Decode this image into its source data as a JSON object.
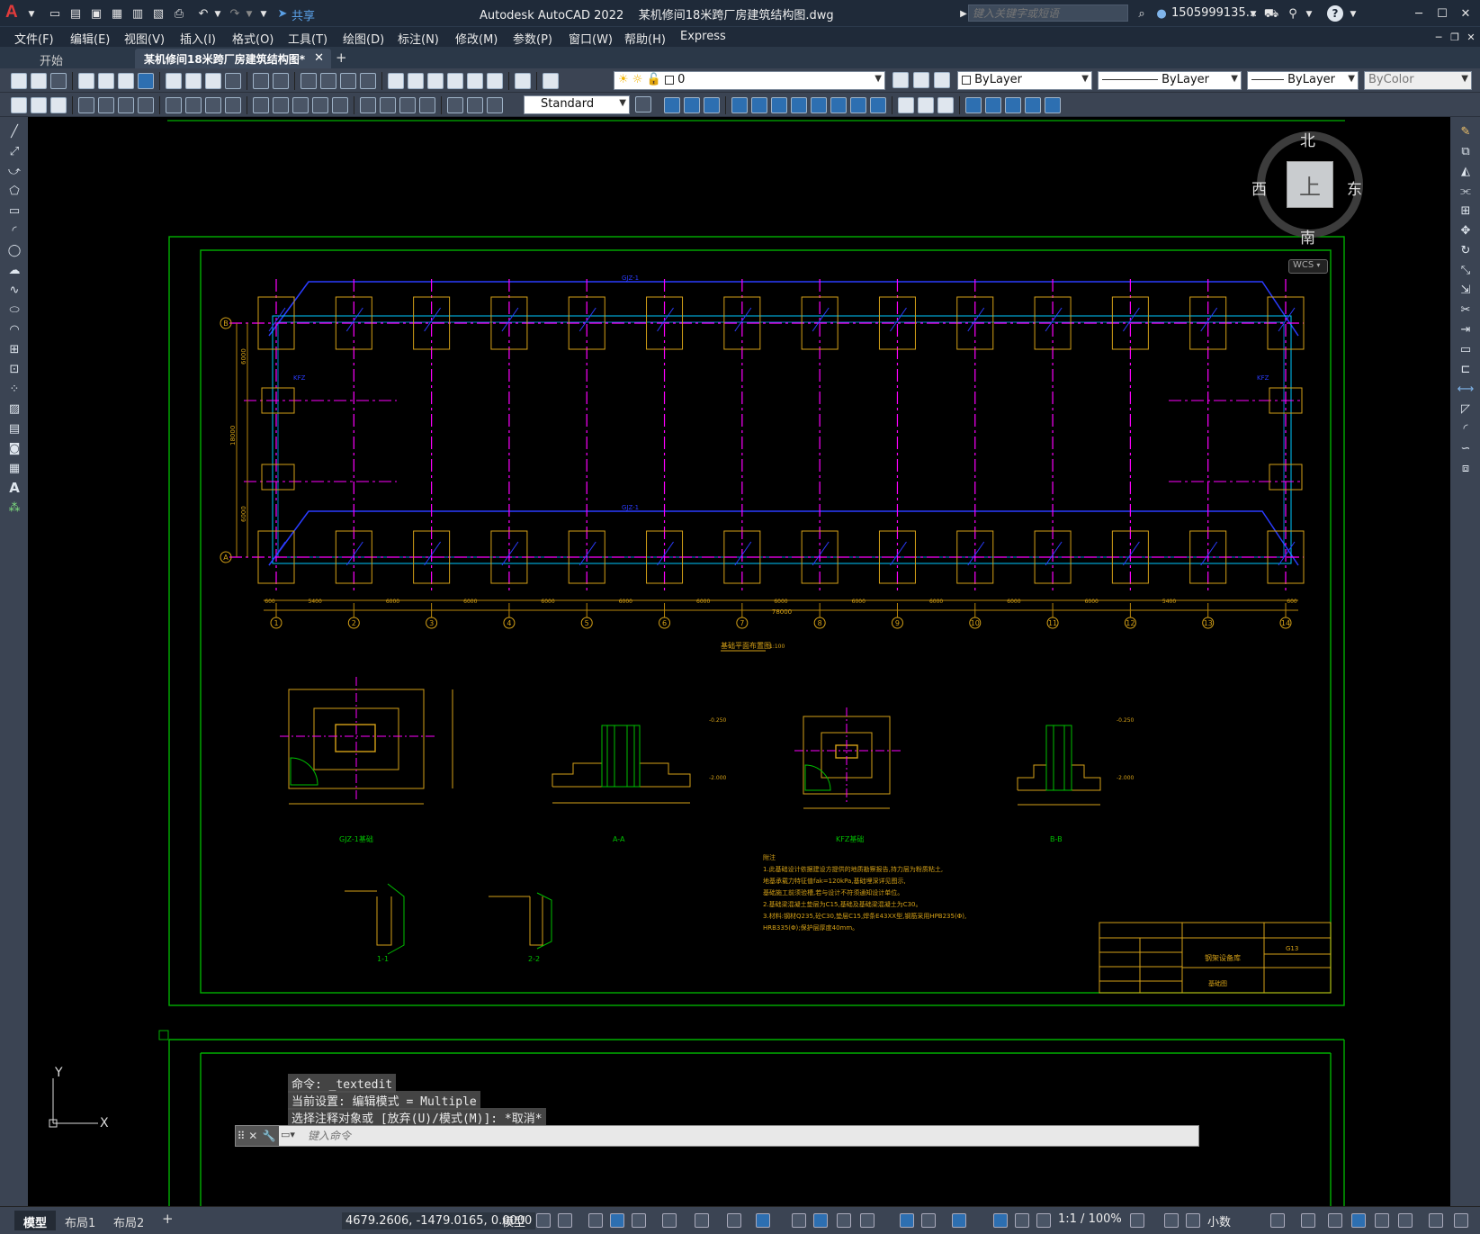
{
  "app": {
    "title": "Autodesk AutoCAD 2022",
    "filename": "某机修间18米跨厂房建筑结构图.dwg",
    "share_label": "共享",
    "search_placeholder": "键入关键字或短语",
    "user": "1505999135...",
    "accent_color": "#c1272d"
  },
  "menu": [
    "文件(F)",
    "编辑(E)",
    "视图(V)",
    "插入(I)",
    "格式(O)",
    "工具(T)",
    "绘图(D)",
    "标注(N)",
    "修改(M)",
    "参数(P)",
    "窗口(W)",
    "帮助(H)",
    "Express"
  ],
  "tabs": {
    "start": "开始",
    "active": "某机修间18米跨厂房建筑结构图*",
    "add": "+"
  },
  "toolbar": {
    "layer_value": "0",
    "color_value": "ByLayer",
    "linetype_value": "ByLayer",
    "lineweight_value": "ByLayer",
    "plotstyle_value": "ByColor",
    "textstyle_value": "Standard"
  },
  "viewcube": {
    "north": "北",
    "south": "南",
    "east": "东",
    "west": "西",
    "top": "上",
    "wcs": "WCS"
  },
  "drawing": {
    "plan_title": "基础平面布置图",
    "plan_scale": "1:100",
    "grid_numbers": [
      "1",
      "2",
      "3",
      "4",
      "5",
      "6",
      "7",
      "8",
      "9",
      "10",
      "11",
      "12",
      "13",
      "14"
    ],
    "grid_letters": [
      "B",
      "A"
    ],
    "spans": [
      "600",
      "5400",
      "6000",
      "6000",
      "6000",
      "6000",
      "6000",
      "6000",
      "6000",
      "6000",
      "6000",
      "6000",
      "5400",
      "600"
    ],
    "overall": "78000",
    "vertical_dims": [
      "6000",
      "18000",
      "6000"
    ],
    "beam_labels": [
      "GJZ-1",
      "GJZ-1"
    ],
    "kfz_label": "KFZ",
    "details": [
      {
        "title": "GJZ-1基础"
      },
      {
        "title": "A-A"
      },
      {
        "title": "KFZ基础"
      },
      {
        "title": "B-B"
      },
      {
        "title": "1-1"
      },
      {
        "title": "2-2"
      }
    ],
    "elev_labels": [
      "-0.250",
      "-2.000",
      "-0.250",
      "-2.000"
    ],
    "notes_title": "附注",
    "notes": [
      "1.此基础设计依据建设方提供的地质勘察报告,持力层为粉质粘土,",
      "  地基承载力特征值fak=120kPa,基础埋深详见图示,",
      "  基础施工前须验槽,若与设计不符须通知设计单位。",
      "2.基础梁混凝土垫层为C15,基础及基础梁混凝土为C30。",
      "3.材料:钢材Q235,砼C30,垫层C15,焊条E43XX型,钢筋采用HPB235(Φ),",
      "  HRB335(Φ);保护层厚度40mm。"
    ],
    "titleblock": {
      "project": "钢架设备库",
      "drawing": "基础图",
      "number": "G13"
    }
  },
  "command": {
    "history": [
      "命令: _textedit",
      "当前设置: 编辑模式 = Multiple",
      "选择注释对象或 [放弃(U)/模式(M)]: *取消*"
    ],
    "placeholder": "键入命令"
  },
  "layout_tabs": [
    "模型",
    "布局1",
    "布局2"
  ],
  "status": {
    "coords": "4679.2606, -1479.0165, 0.0000",
    "model": "模型",
    "scale": "1:1 / 100%",
    "units": "小数"
  }
}
